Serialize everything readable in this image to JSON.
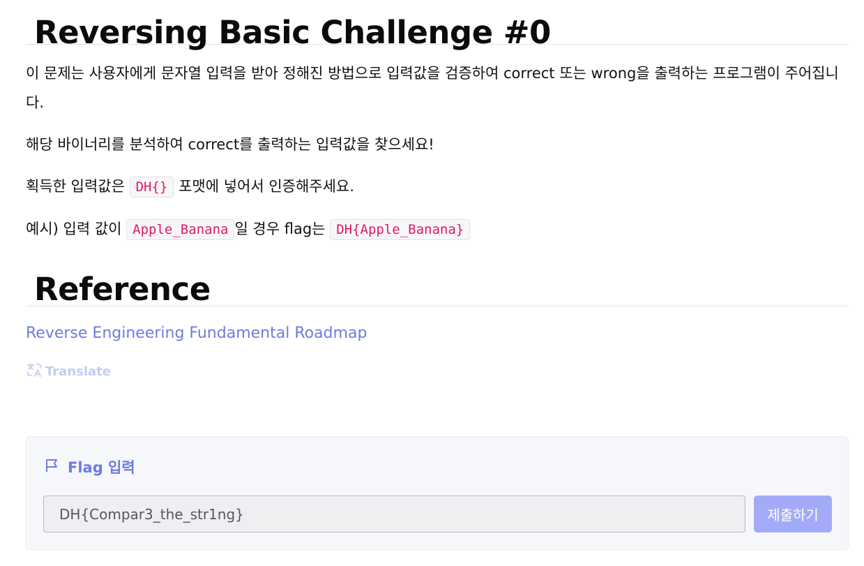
{
  "challenge": {
    "title": "Reversing Basic Challenge #0",
    "description": "이 문제는 사용자에게 문자열 입력을 받아 정해진 방법으로 입력값을 검증하여 correct 또는 wrong을 출력하는 프로그램이 주어집니다.",
    "hint": "해당 바이너리를 분석하여 correct를 출력하는 입력값을 찾으세요!",
    "format": {
      "prefix": "획득한 입력값은",
      "code": "DH{}",
      "suffix": "포맷에 넣어서 인증해주세요."
    },
    "example": {
      "prefix": "예시) 입력 값이",
      "code_input": "Apple_Banana",
      "middle": "일 경우 flag는",
      "code_flag": "DH{Apple_Banana}"
    }
  },
  "reference": {
    "heading": "Reference",
    "link_text": "Reverse Engineering Fundamental Roadmap"
  },
  "translate": {
    "label": "Translate",
    "icon": "translate-icon"
  },
  "flag_form": {
    "header_label": "Flag 입력",
    "header_icon": "flag-icon",
    "input_value": "DH{Compar3_the_str1ng}",
    "submit_label": "제출하기"
  },
  "colors": {
    "accent": "#6d7bdf",
    "button_bg": "#a3abf8",
    "code_text": "#dd1a64",
    "translate": "#c6cbf2"
  }
}
